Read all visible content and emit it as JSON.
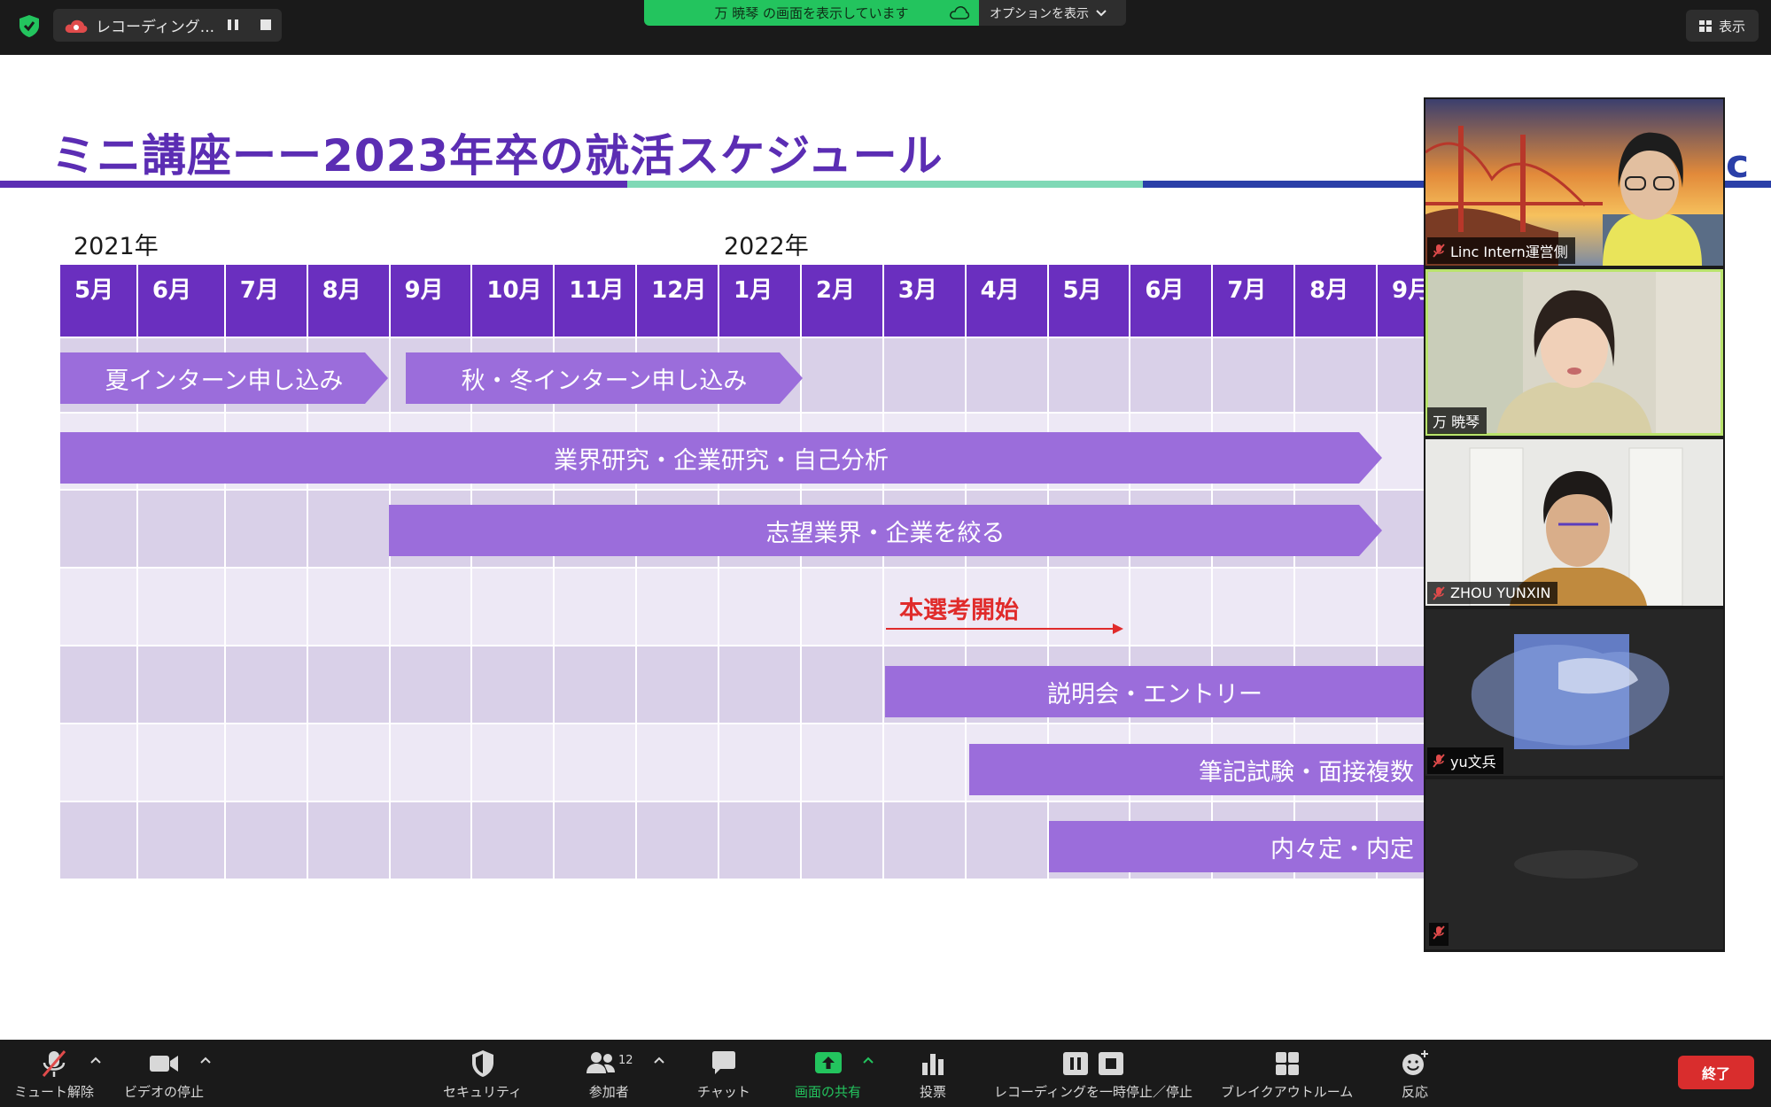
{
  "topbar": {
    "recording_label": "レコーディング...",
    "share_banner": "万 暁琴 の画面を表示しています",
    "options_label": "オプションを表示",
    "view_label": "表示"
  },
  "slide": {
    "title": "ミニ講座ーー2023年卒の就活スケジュール",
    "brand_fragment": "c",
    "year_2021": "2021年",
    "year_2022": "2022年",
    "months": [
      "5月",
      "6月",
      "7月",
      "8月",
      "9月",
      "10月",
      "11月",
      "12月",
      "1月",
      "2月",
      "3月",
      "4月",
      "5月",
      "6月",
      "7月",
      "8月",
      "9月"
    ],
    "bands": {
      "summer_intern": "夏インターン申し込み",
      "autumn_winter_intern": "秋・冬インターン申し込み",
      "research": "業界研究・企業研究・自己分析",
      "narrow": "志望業界・企業を絞る",
      "selection_start": "本選考開始",
      "briefing": "説明会・エントリー",
      "exams": "筆記試験・面接複数",
      "offer": "内々定・内定"
    }
  },
  "participants": [
    {
      "name": "Linc Intern運営側",
      "muted": true
    },
    {
      "name": "万 暁琴",
      "muted": false,
      "active_speaker": true
    },
    {
      "name": "ZHOU YUNXIN",
      "muted": true
    },
    {
      "name": "yu文兵",
      "muted": true
    },
    {
      "name": "",
      "muted": true
    }
  ],
  "toolbar": {
    "unmute": "ミュート解除",
    "stop_video": "ビデオの停止",
    "security": "セキュリティ",
    "participants": "参加者",
    "participant_count": "12",
    "chat": "チャット",
    "share_screen": "画面の共有",
    "polls": "投票",
    "pause_stop_recording": "レコーディングを一時停止／停止",
    "breakout_rooms": "ブレイクアウトルーム",
    "reactions": "反応",
    "end": "終了"
  },
  "colors": {
    "accent_green": "#23c45e",
    "slide_purple": "#6a2fbf",
    "band_purple": "#9b6ddb",
    "end_red": "#d92d2d"
  }
}
